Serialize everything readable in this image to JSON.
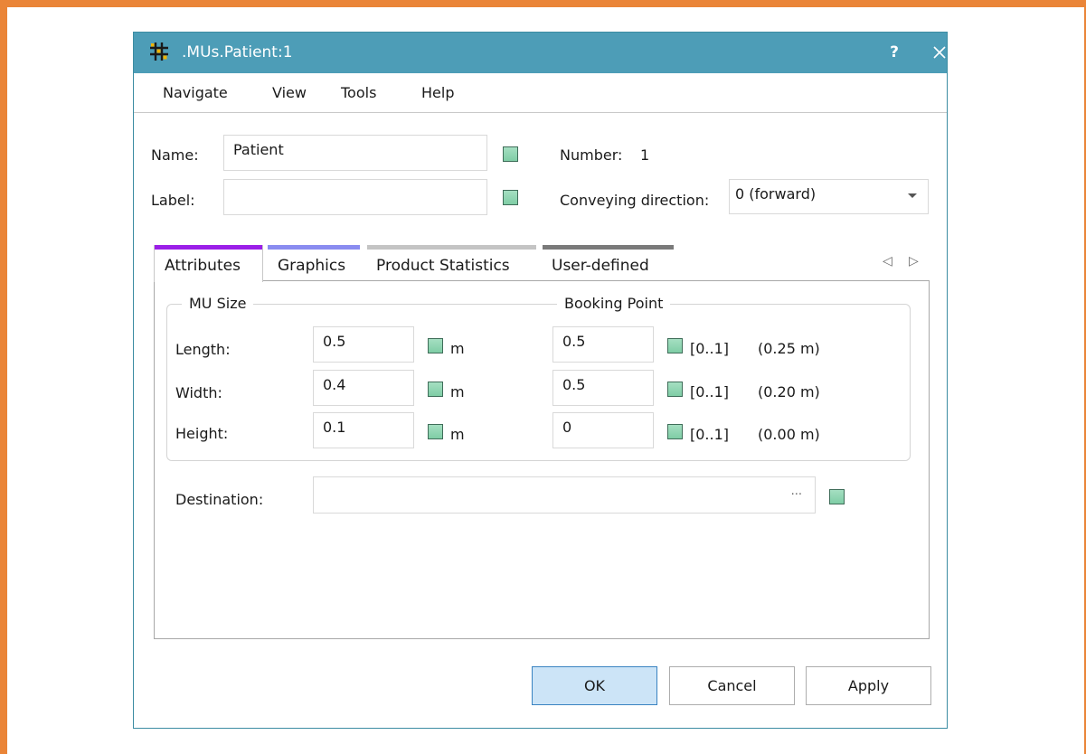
{
  "window": {
    "title": ".MUs.Patient:1",
    "help_label": "?",
    "close_label": "✕"
  },
  "menu": {
    "items": [
      "Navigate",
      "View",
      "Tools",
      "Help"
    ]
  },
  "header": {
    "name_label": "Name:",
    "name_value": "Patient",
    "label_label": "Label:",
    "label_value": "",
    "number_label": "Number:",
    "number_value": "1",
    "conveying_label": "Conveying direction:",
    "conveying_value": "0 (forward)"
  },
  "tabs": [
    {
      "label": "Attributes",
      "color": "#9b1fe8",
      "active": true
    },
    {
      "label": "Graphics",
      "color": "#8a8cf0",
      "active": false
    },
    {
      "label": "Product Statistics",
      "color": "#c4c4c4",
      "active": false
    },
    {
      "label": "User-defined",
      "color": "#7a7a7a",
      "active": false
    }
  ],
  "tab_scroll": {
    "left": "◁",
    "right": "▷"
  },
  "attributes": {
    "mu_size_title": "MU Size",
    "booking_point_title": "Booking Point",
    "rows": [
      {
        "label": "Length:",
        "size": "0.5",
        "size_unit": "m",
        "booking": "0.5",
        "range": "[0..1]",
        "computed": "(0.25 m)"
      },
      {
        "label": "Width:",
        "size": "0.4",
        "size_unit": "m",
        "booking": "0.5",
        "range": "[0..1]",
        "computed": "(0.20 m)"
      },
      {
        "label": "Height:",
        "size": "0.1",
        "size_unit": "m",
        "booking": "0",
        "range": "[0..1]",
        "computed": "(0.00 m)"
      }
    ],
    "destination_label": "Destination:",
    "destination_value": "",
    "destination_browse": "..."
  },
  "buttons": {
    "ok": "OK",
    "cancel": "Cancel",
    "apply": "Apply"
  },
  "colors": {
    "titlebar": "#4d9db7",
    "frame_accent": "#ea8538",
    "checkbox": "#8fd4b0"
  }
}
